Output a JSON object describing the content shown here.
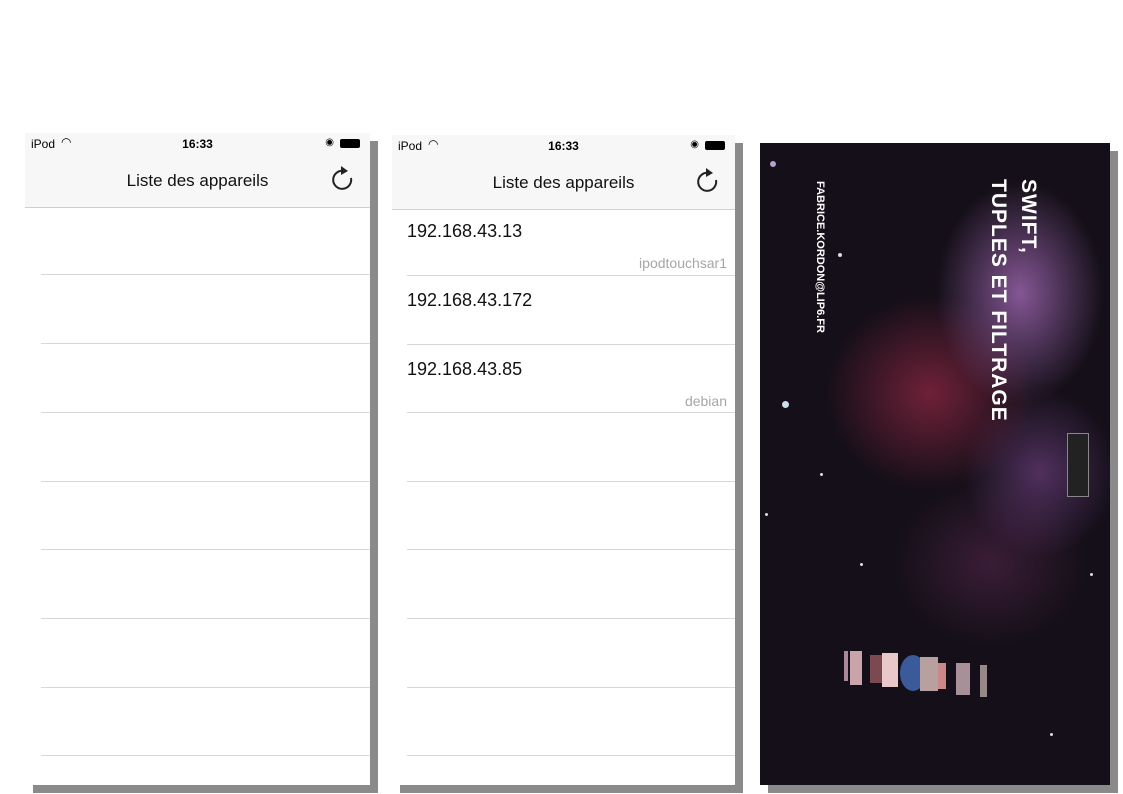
{
  "status": {
    "carrier": "iPod",
    "time": "16:33"
  },
  "nav": {
    "title": "Liste des appareils"
  },
  "devices": [
    {
      "ip": "192.168.43.13",
      "host": "ipodtouchsar1"
    },
    {
      "ip": "192.168.43.172",
      "host": ""
    },
    {
      "ip": "192.168.43.85",
      "host": "debian"
    }
  ],
  "cover": {
    "title_line1": "SWIFT,",
    "title_line2": "TUPLES ET FILTRAGE",
    "author": "FABRICE.KORDON@LIP6.FR"
  }
}
